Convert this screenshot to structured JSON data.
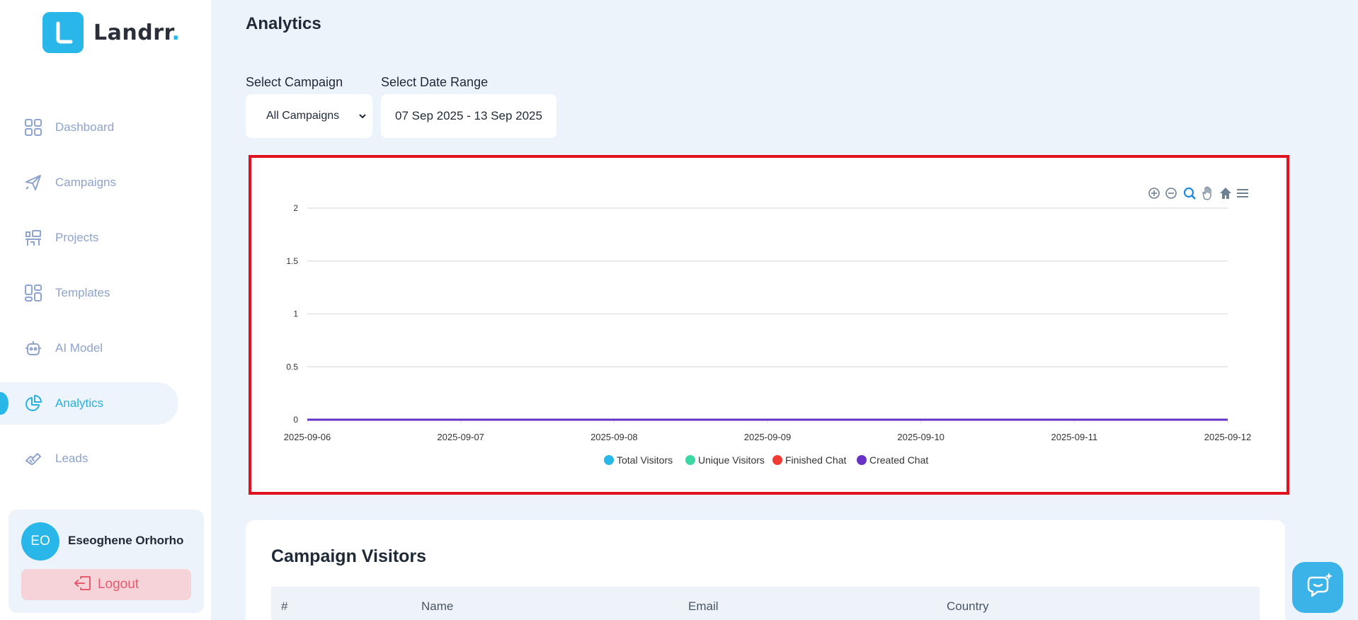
{
  "brand": {
    "name": "Landrr",
    "dot": "."
  },
  "sidebar": {
    "items": [
      {
        "label": "Dashboard",
        "icon": "grid-icon"
      },
      {
        "label": "Campaigns",
        "icon": "paper-plane-icon"
      },
      {
        "label": "Projects",
        "icon": "workspace-icon"
      },
      {
        "label": "Templates",
        "icon": "templates-icon"
      },
      {
        "label": "AI Model",
        "icon": "robot-icon"
      },
      {
        "label": "Analytics",
        "icon": "pie-chart-icon",
        "active": true
      },
      {
        "label": "Leads",
        "icon": "handshake-icon"
      }
    ]
  },
  "user": {
    "initials": "EO",
    "name": "Eseoghene Orhorho",
    "logout_label": "Logout"
  },
  "page": {
    "title": "Analytics"
  },
  "filters": {
    "campaign_label": "Select Campaign",
    "campaign_value": "All Campaigns",
    "date_label": "Select Date Range",
    "date_value": "07 Sep 2025 - 13 Sep 2025"
  },
  "chart_toolbar": [
    "zoom-in-icon",
    "zoom-out-icon",
    "zoom-select-icon",
    "pan-icon",
    "reset-home-icon",
    "menu-icon"
  ],
  "chart_data": {
    "type": "line",
    "x": [
      "2025-09-06",
      "2025-09-07",
      "2025-09-08",
      "2025-09-09",
      "2025-09-10",
      "2025-09-11",
      "2025-09-12"
    ],
    "y_ticks": [
      "2",
      "1.5",
      "1",
      "0.5",
      "0"
    ],
    "ylim": [
      0,
      2
    ],
    "grid": true,
    "legend_position": "bottom",
    "series": [
      {
        "name": "Total Visitors",
        "color": "#29b6e8",
        "values": [
          0,
          0,
          0,
          0,
          0,
          0,
          0
        ]
      },
      {
        "name": "Unique Visitors",
        "color": "#3dd6a5",
        "values": [
          0,
          0,
          0,
          0,
          0,
          0,
          0
        ]
      },
      {
        "name": "Finished Chat",
        "color": "#ef3b34",
        "values": [
          0,
          0,
          0,
          0,
          0,
          0,
          0
        ]
      },
      {
        "name": "Created Chat",
        "color": "#6633c4",
        "values": [
          0,
          0,
          0,
          0,
          0,
          0,
          0
        ]
      }
    ]
  },
  "visitors_table": {
    "title": "Campaign Visitors",
    "columns": [
      "#",
      "Name",
      "Email",
      "Country"
    ]
  }
}
